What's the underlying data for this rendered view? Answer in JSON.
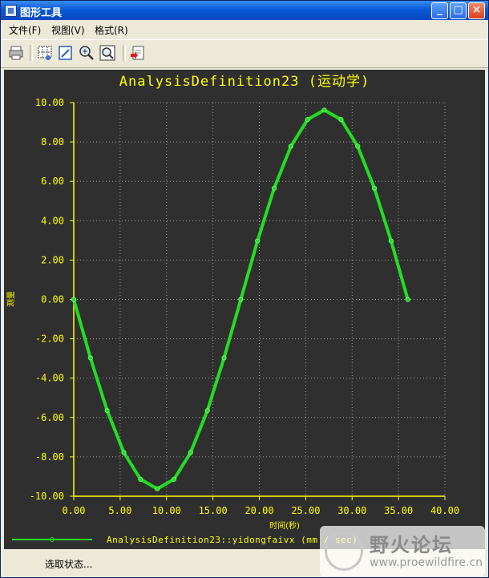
{
  "window": {
    "title": "图形工具"
  },
  "menu": [
    {
      "label": "文件(F)"
    },
    {
      "label": "视图(V)"
    },
    {
      "label": "格式(R)"
    }
  ],
  "toolbar": {
    "tools": [
      "print-icon",
      "grid-view-icon",
      "edit-icon",
      "zoom-in-icon",
      "zoom-fit-icon",
      "export-icon"
    ]
  },
  "status": {
    "text": "选取状态..."
  },
  "watermark": {
    "title": "野火论坛",
    "url": "www.proewildfire.cn"
  },
  "colors": {
    "plot_bg": "#2f2f2f",
    "axis": "#ffff00",
    "series": "#22dd22",
    "grid": "#a0a0a0",
    "window": "#ece9d8"
  },
  "chart_data": {
    "type": "line",
    "title": "AnalysisDefinition23 (运动学)",
    "xlabel": "时间(秒)",
    "ylabel": "测量",
    "xlim": [
      0,
      40
    ],
    "ylim": [
      -10,
      10
    ],
    "xticks": [
      "0.00",
      "5.00",
      "10.00",
      "15.00",
      "20.00",
      "25.00",
      "30.00",
      "35.00",
      "40.00"
    ],
    "yticks": [
      "10.00",
      "8.00",
      "6.00",
      "4.00",
      "2.00",
      "0.00",
      "-2.00",
      "-4.00",
      "-6.00",
      "-8.00",
      "-10.00"
    ],
    "grid": true,
    "legend": "bottom",
    "series": [
      {
        "name": "AnalysisDefinition23::yidongfaivx (mm / sec)",
        "x": [
          0,
          1.8,
          3.6,
          5.4,
          7.2,
          9.0,
          10.8,
          12.6,
          14.4,
          16.2,
          18.0,
          19.8,
          21.6,
          23.4,
          25.2,
          27.0,
          28.8,
          30.6,
          32.4,
          34.2,
          36.0
        ],
        "y": [
          0,
          -2.97,
          -5.65,
          -7.78,
          -9.14,
          -9.62,
          -9.14,
          -7.78,
          -5.65,
          -2.97,
          0,
          2.97,
          5.65,
          7.78,
          9.14,
          9.62,
          9.14,
          7.78,
          5.65,
          2.97,
          0
        ]
      }
    ]
  }
}
